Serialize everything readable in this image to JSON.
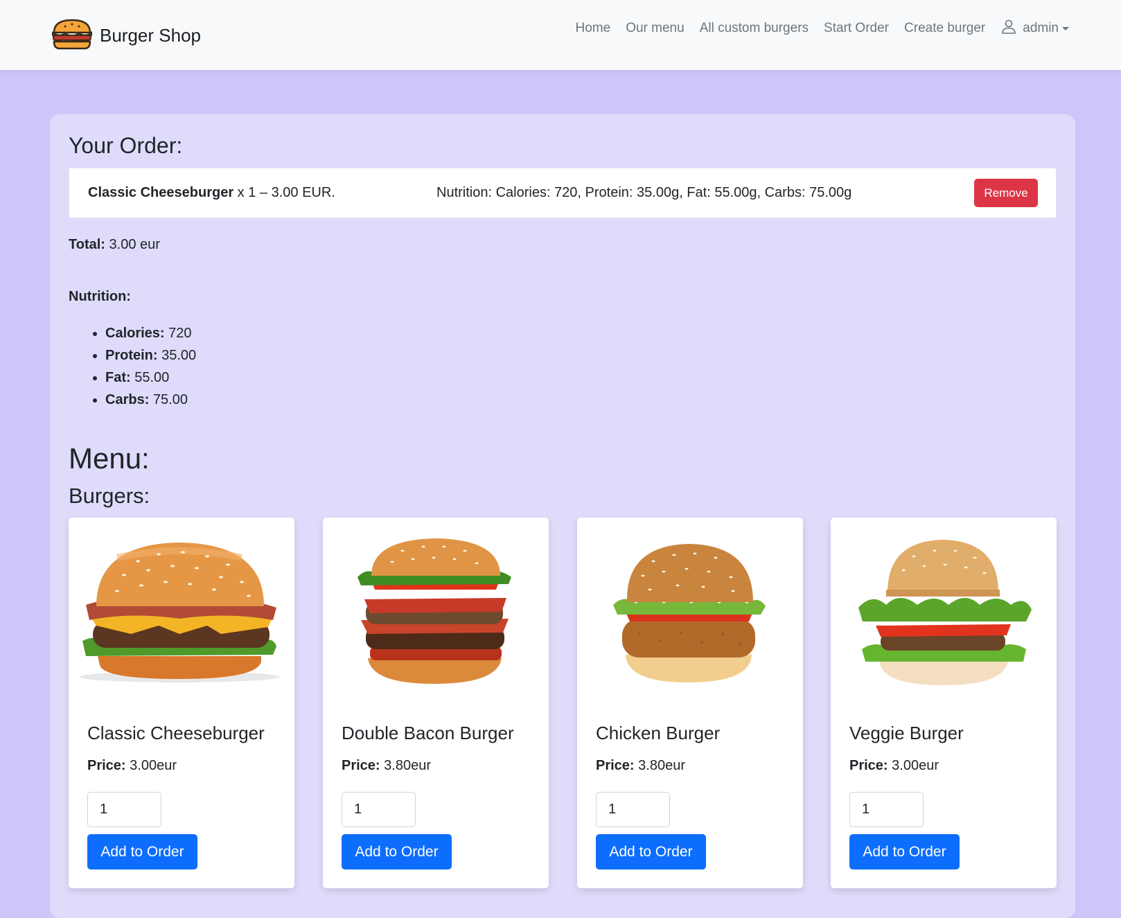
{
  "navbar": {
    "brand": "Burger Shop",
    "links": [
      "Home",
      "Our menu",
      "All custom burgers",
      "Start Order",
      "Create burger"
    ],
    "user": "admin"
  },
  "order": {
    "heading": "Your Order:",
    "item": {
      "name": "Classic Cheeseburger",
      "detail": " x 1 – 3.00 EUR.",
      "nutrition": "Nutrition: Calories: 720, Protein: 35.00g, Fat: 55.00g, Carbs: 75.00g",
      "remove_label": "Remove"
    },
    "total_label": "Total:",
    "total_value": " 3.00 eur",
    "nutrition_label": "Nutrition:",
    "nutrition": [
      {
        "label": "Calories:",
        "value": " 720"
      },
      {
        "label": "Protein:",
        "value": " 35.00"
      },
      {
        "label": "Fat:",
        "value": " 55.00"
      },
      {
        "label": "Carbs:",
        "value": " 75.00"
      }
    ]
  },
  "menu": {
    "heading": "Menu:",
    "subheading": "Burgers:",
    "price_label": "Price:",
    "add_label": "Add to Order",
    "burgers": [
      {
        "name": "Classic Cheeseburger",
        "price": " 3.00eur",
        "qty": "1",
        "image": "cheeseburger-photo"
      },
      {
        "name": "Double Bacon Burger",
        "price": " 3.80eur",
        "qty": "1",
        "image": "double-bacon-burger-photo"
      },
      {
        "name": "Chicken Burger",
        "price": " 3.80eur",
        "qty": "1",
        "image": "chicken-burger-photo"
      },
      {
        "name": "Veggie Burger",
        "price": " 3.00eur",
        "qty": "1",
        "image": "veggie-burger-photo"
      }
    ]
  },
  "colors": {
    "page_bg": "#cdc6f8",
    "panel_bg": "#dfdbfb",
    "primary": "#0d6efd",
    "danger": "#dc3545"
  }
}
